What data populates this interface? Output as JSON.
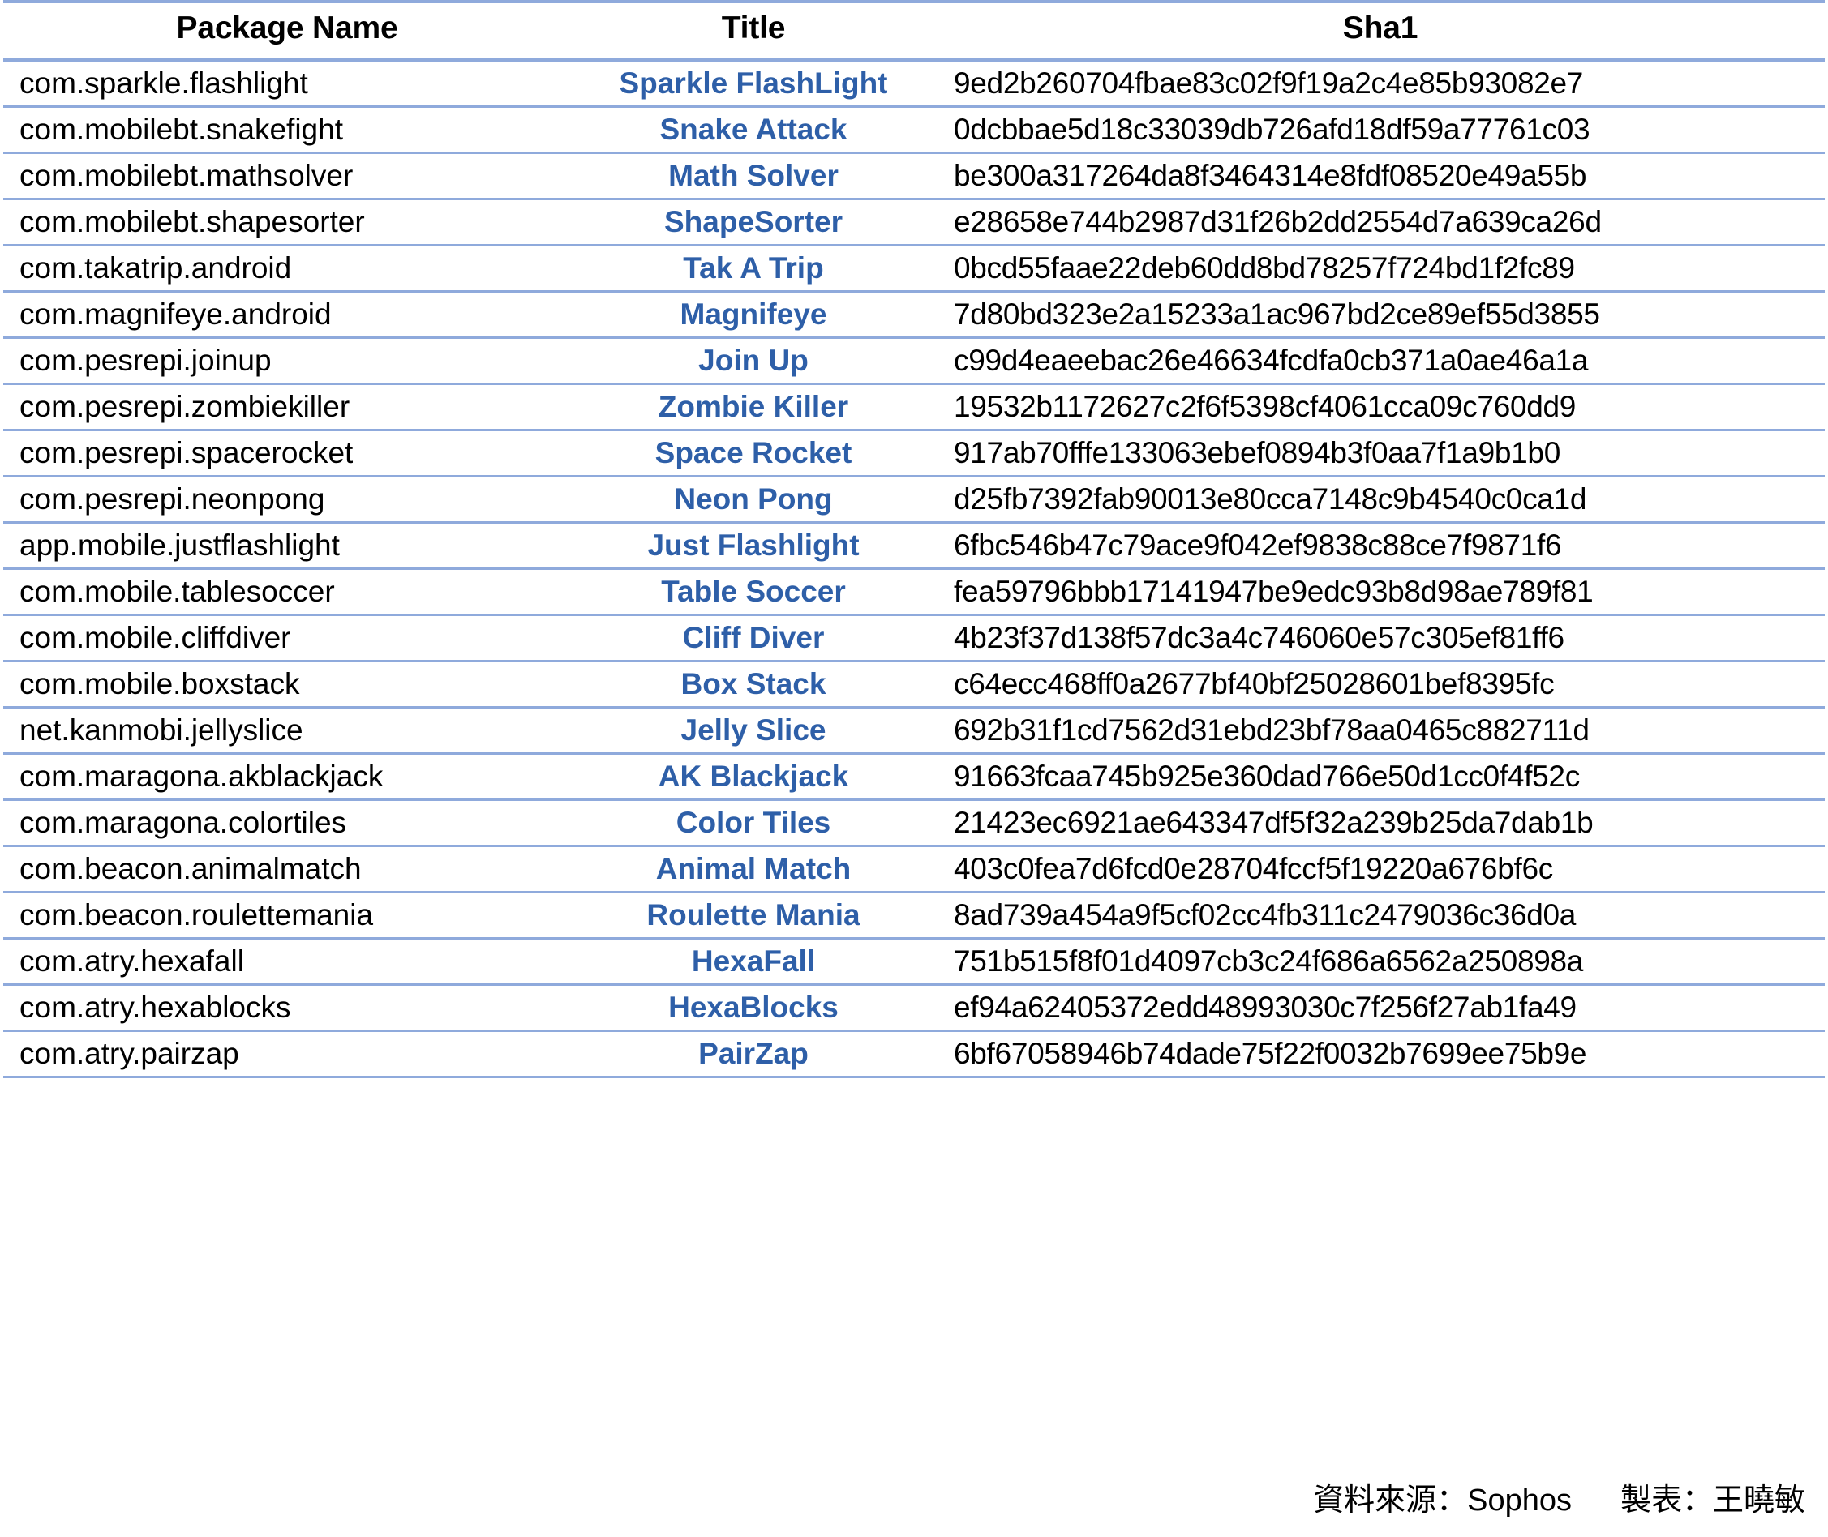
{
  "table": {
    "columns": [
      "Package Name",
      "Title",
      "Sha1"
    ],
    "rows": [
      {
        "package": "com.sparkle.flashlight",
        "title": "Sparkle FlashLight",
        "sha1": "9ed2b260704fbae83c02f9f19a2c4e85b93082e7"
      },
      {
        "package": "com.mobilebt.snakefight",
        "title": "Snake Attack",
        "sha1": "0dcbbae5d18c33039db726afd18df59a77761c03"
      },
      {
        "package": "com.mobilebt.mathsolver",
        "title": "Math Solver",
        "sha1": "be300a317264da8f3464314e8fdf08520e49a55b"
      },
      {
        "package": "com.mobilebt.shapesorter",
        "title": "ShapeSorter",
        "sha1": "e28658e744b2987d31f26b2dd2554d7a639ca26d"
      },
      {
        "package": "com.takatrip.android",
        "title": "Tak A Trip",
        "sha1": "0bcd55faae22deb60dd8bd78257f724bd1f2fc89"
      },
      {
        "package": "com.magnifeye.android",
        "title": "Magnifeye",
        "sha1": "7d80bd323e2a15233a1ac967bd2ce89ef55d3855"
      },
      {
        "package": "com.pesrepi.joinup",
        "title": "Join Up",
        "sha1": "c99d4eaeebac26e46634fcdfa0cb371a0ae46a1a"
      },
      {
        "package": "com.pesrepi.zombiekiller",
        "title": "Zombie Killer",
        "sha1": "19532b1172627c2f6f5398cf4061cca09c760dd9"
      },
      {
        "package": "com.pesrepi.spacerocket",
        "title": "Space Rocket",
        "sha1": "917ab70fffe133063ebef0894b3f0aa7f1a9b1b0"
      },
      {
        "package": "com.pesrepi.neonpong",
        "title": "Neon Pong",
        "sha1": "d25fb7392fab90013e80cca7148c9b4540c0ca1d"
      },
      {
        "package": "app.mobile.justflashlight",
        "title": "Just Flashlight",
        "sha1": "6fbc546b47c79ace9f042ef9838c88ce7f9871f6"
      },
      {
        "package": "com.mobile.tablesoccer",
        "title": "Table Soccer",
        "sha1": "fea59796bbb17141947be9edc93b8d98ae789f81"
      },
      {
        "package": "com.mobile.cliffdiver",
        "title": "Cliff Diver",
        "sha1": "4b23f37d138f57dc3a4c746060e57c305ef81ff6"
      },
      {
        "package": "com.mobile.boxstack",
        "title": "Box Stack",
        "sha1": "c64ecc468ff0a2677bf40bf25028601bef8395fc"
      },
      {
        "package": "net.kanmobi.jellyslice",
        "title": "Jelly Slice",
        "sha1": "692b31f1cd7562d31ebd23bf78aa0465c882711d"
      },
      {
        "package": "com.maragona.akblackjack",
        "title": "AK Blackjack",
        "sha1": "91663fcaa745b925e360dad766e50d1cc0f4f52c"
      },
      {
        "package": "com.maragona.colortiles",
        "title": "Color Tiles",
        "sha1": "21423ec6921ae643347df5f32a239b25da7dab1b"
      },
      {
        "package": "com.beacon.animalmatch",
        "title": "Animal Match",
        "sha1": "403c0fea7d6fcd0e28704fccf5f19220a676bf6c"
      },
      {
        "package": "com.beacon.roulettemania",
        "title": "Roulette Mania",
        "sha1": "8ad739a454a9f5cf02cc4fb311c2479036c36d0a"
      },
      {
        "package": "com.atry.hexafall",
        "title": "HexaFall",
        "sha1": "751b515f8f01d4097cb3c24f686a6562a250898a"
      },
      {
        "package": "com.atry.hexablocks",
        "title": "HexaBlocks",
        "sha1": "ef94a62405372edd48993030c7f256f27ab1fa49"
      },
      {
        "package": "com.atry.pairzap",
        "title": "PairZap",
        "sha1": "6bf67058946b74dade75f22f0032b7699ee75b9e"
      }
    ]
  },
  "footer": {
    "source": "資料來源：Sophos",
    "author": "製表：王曉敏"
  },
  "colors": {
    "rule": "#8faadc",
    "title_text": "#2e5fa8",
    "body_text": "#000000",
    "background": "#ffffff"
  }
}
